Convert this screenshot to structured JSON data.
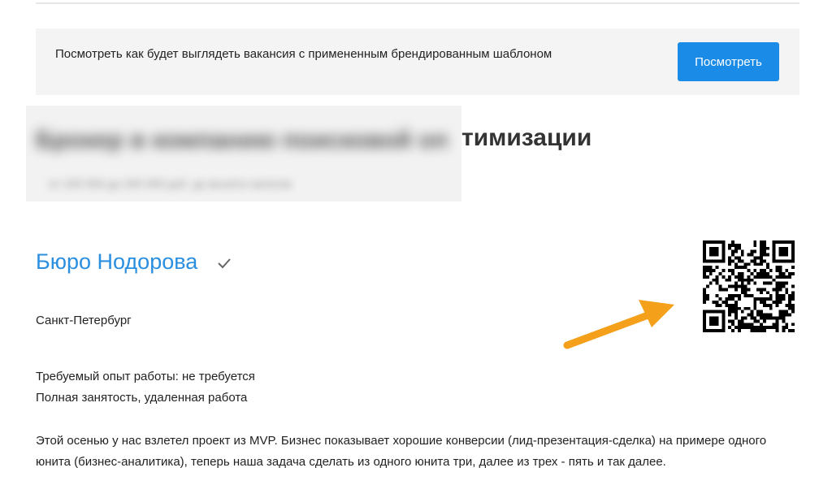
{
  "banner": {
    "text": "Посмотреть как будет выглядеть вакансия с примененным брендированным шаблоном",
    "button_label": "Посмотреть"
  },
  "vacancy": {
    "title_visible_part": "тимизации",
    "company": "Бюро Нодорова",
    "city": "Санкт-Петербург",
    "experience": "Требуемый опыт работы: не требуется",
    "employment": "Полная занятость, удаленная работа",
    "description": "Этой осенью у нас взлетел проект из MVP. Бизнес показывает хорошие конверсии (лид-презентация-сделка) на примере одного юнита (бизнес-аналитика), теперь наша задача сделать из одного юнита три, далее из трех - пять и так далее."
  },
  "icons": {
    "verified": "check-icon",
    "qr": "qr-code-icon",
    "annotation": "arrow-icon"
  },
  "colors": {
    "accent": "#1a8be6",
    "link": "#2b8fe0",
    "arrow": "#f5a01a"
  }
}
